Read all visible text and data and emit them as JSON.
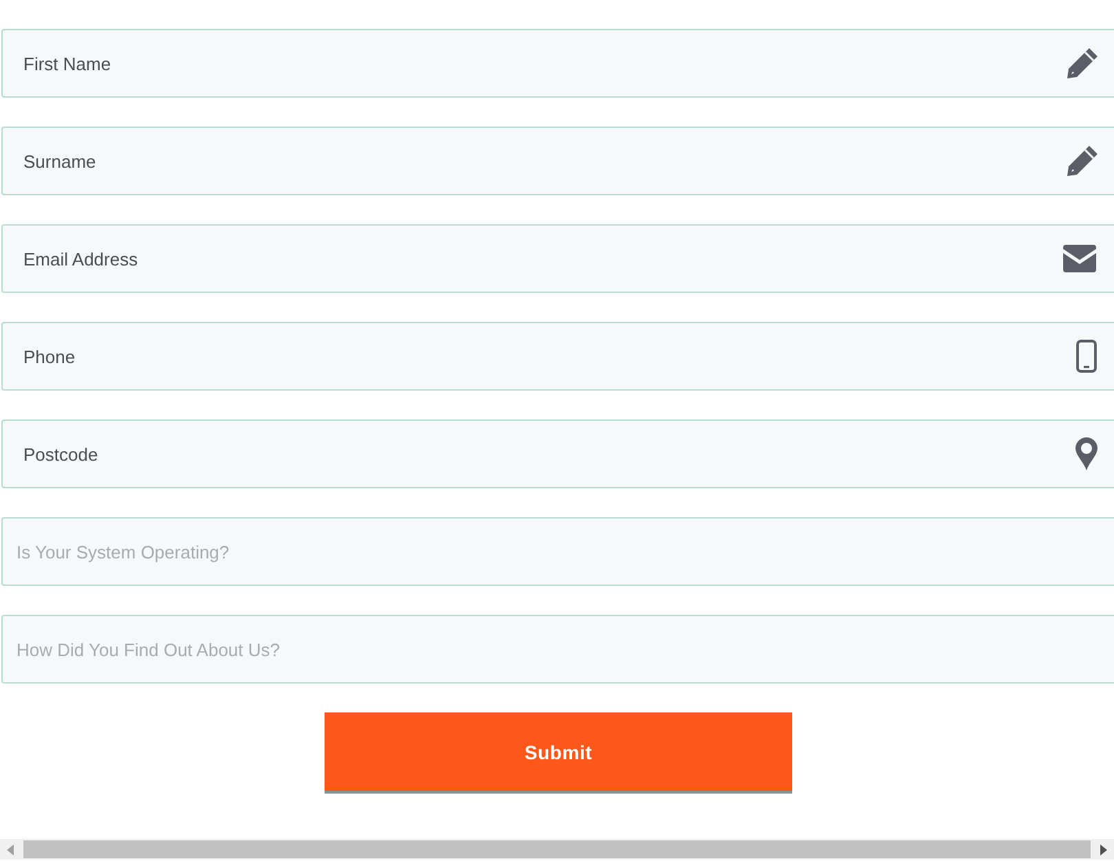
{
  "fields": [
    {
      "placeholder": "First Name",
      "kind": "name"
    },
    {
      "placeholder": "Surname",
      "kind": "name"
    },
    {
      "placeholder": "Email Address",
      "kind": "email"
    },
    {
      "placeholder": "Phone",
      "kind": "phone"
    },
    {
      "placeholder": "Postcode",
      "kind": "postcode"
    },
    {
      "placeholder": "Is Your System Operating?",
      "kind": "plain"
    },
    {
      "placeholder": "How Did You Find Out About Us?",
      "kind": "plain"
    }
  ],
  "submit": "Submit"
}
